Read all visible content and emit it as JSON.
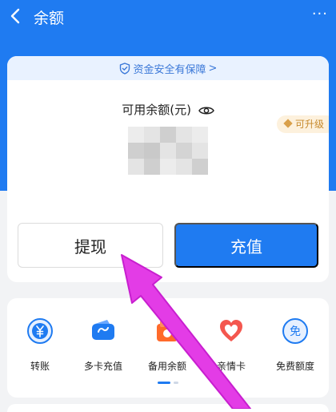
{
  "header": {
    "title": "余额",
    "back_icon": "chevron-left-icon",
    "more_icon": "more-dots-icon",
    "more_glyph": "···"
  },
  "safety_banner": {
    "text": "资金安全有保障",
    "chevron": ">",
    "icon": "shield-check-icon"
  },
  "balance": {
    "label": "可用余额(元)",
    "eye_icon": "eye-icon",
    "value_hidden": true
  },
  "upgrade_badge": {
    "text": "可升级",
    "icon": "gem-icon"
  },
  "actions": {
    "withdraw_label": "提现",
    "topup_label": "充值"
  },
  "services": [
    {
      "label": "转账",
      "icon": "yuan-circle-icon"
    },
    {
      "label": "多卡充值",
      "icon": "wallet-icon"
    },
    {
      "label": "备用余额",
      "icon": "spare-balance-icon"
    },
    {
      "label": "亲情卡",
      "icon": "heart-card-icon"
    },
    {
      "label": "免费额度",
      "icon": "free-quota-icon"
    }
  ],
  "free_glyph": "免",
  "colors": {
    "primary": "#1f7bf1",
    "banner_bg": "#e9f2ff",
    "badge_bg": "#fdf1dd",
    "badge_text": "#c78a2d",
    "annotation_arrow": "#e33ce6"
  }
}
